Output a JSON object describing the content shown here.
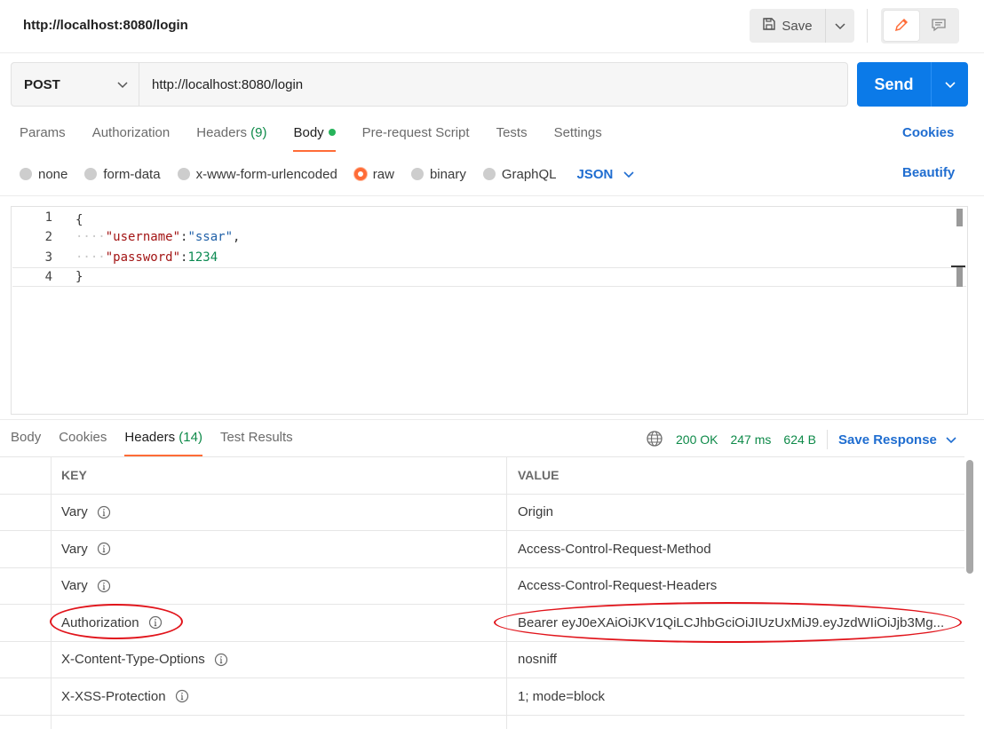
{
  "request": {
    "title": "http://localhost:8080/login",
    "save_label": "Save",
    "method": "POST",
    "url": "http://localhost:8080/login",
    "send_label": "Send"
  },
  "request_tabs": [
    {
      "label": "Params"
    },
    {
      "label": "Authorization"
    },
    {
      "label": "Headers",
      "count": "(9)"
    },
    {
      "label": "Body"
    },
    {
      "label": "Pre-request Script"
    },
    {
      "label": "Tests"
    },
    {
      "label": "Settings"
    }
  ],
  "cookies_label": "Cookies",
  "body_types": [
    {
      "label": "none",
      "selected": false
    },
    {
      "label": "form-data",
      "selected": false
    },
    {
      "label": "x-www-form-urlencoded",
      "selected": false
    },
    {
      "label": "raw",
      "selected": true
    },
    {
      "label": "binary",
      "selected": false
    },
    {
      "label": "GraphQL",
      "selected": false
    }
  ],
  "body_format": "JSON",
  "beautify_label": "Beautify",
  "editor": {
    "line_numbers": [
      "1",
      "2",
      "3",
      "4"
    ],
    "open_brace": "{",
    "close_brace": "}",
    "username_key": "\"username\"",
    "username_value": "\"ssar\"",
    "password_key": "\"password\"",
    "password_value": "1234"
  },
  "response_tabs": [
    {
      "label": "Body"
    },
    {
      "label": "Cookies"
    },
    {
      "label": "Headers",
      "count": "(14)"
    },
    {
      "label": "Test Results"
    }
  ],
  "response_meta": {
    "status": "200 OK",
    "time": "247 ms",
    "size": "624 B",
    "save_response_label": "Save Response"
  },
  "headers_table": {
    "key_header": "KEY",
    "value_header": "VALUE",
    "rows": [
      {
        "key": "Vary",
        "value": "Origin"
      },
      {
        "key": "Vary",
        "value": "Access-Control-Request-Method"
      },
      {
        "key": "Vary",
        "value": "Access-Control-Request-Headers"
      },
      {
        "key": "Authorization",
        "value": "Bearer eyJ0eXAiOiJKV1QiLCJhbGciOiJIUzUxMiJ9.eyJzdWIiOiJjb3Mg..."
      },
      {
        "key": "X-Content-Type-Options",
        "value": "nosniff"
      },
      {
        "key": "X-XSS-Protection",
        "value": "1; mode=block"
      }
    ]
  },
  "colors": {
    "accent": "#ff6c37",
    "send": "#0b7ae8",
    "link": "#1f6dd0",
    "status_green": "#0e8a49",
    "annotation_red": "#e1141b"
  }
}
